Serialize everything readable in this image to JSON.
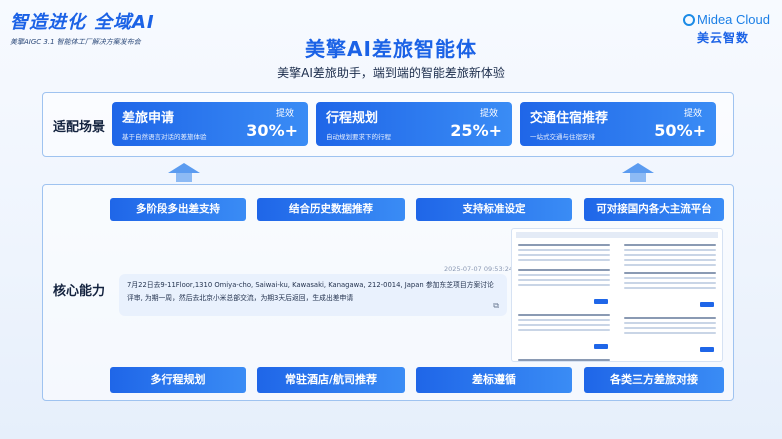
{
  "header": {
    "brand_title_1": "智造进化",
    "brand_title_2": "全域AI",
    "brand_sub": "美擎AIGC 3.1 智能体工厂解决方案发布会",
    "logo_en": "Midea Cloud",
    "logo_cn": "美云智数"
  },
  "title": "美擎AI差旅智能体",
  "subtitle": "美擎AI差旅助手，端到端的智能差旅新体验",
  "scenes": {
    "label": "适配场景",
    "cards": [
      {
        "title": "差旅申请",
        "desc": "基于自然语言对话的差旅体验",
        "kpi_label": "提效",
        "kpi_value": "30%+"
      },
      {
        "title": "行程规划",
        "desc": "自动规划要求下的行程",
        "kpi_label": "提效",
        "kpi_value": "25%+"
      },
      {
        "title": "交通住宿推荐",
        "desc": "一站式交通与住宿安排",
        "kpi_label": "提效",
        "kpi_value": "50%+"
      }
    ]
  },
  "core": {
    "label": "核心能力",
    "top_features": [
      "多阶段多出差支持",
      "结合历史数据推荐",
      "支持标准设定",
      "可对接国内各大主流平台"
    ],
    "bottom_features": [
      "多行程规划",
      "常驻酒店/航司推荐",
      "差标遵循",
      "各类三方差旅对接"
    ],
    "chat": {
      "timestamp": "2025-07-07 09:53:24",
      "message": "7月22日去9-11Floor,1310 Omiya-cho, Saiwai-ku, Kawasaki, Kanagawa, 212-0014, Japan 参加东芝项目方案讨论评审, 为期一周，然后去北京小米总部交流，为期3天后返回，生成出差申请",
      "icon": "copy-icon"
    }
  },
  "colors": {
    "accent": "#1f66e8",
    "accent_light": "#3a8cf5",
    "panel_border": "#9fc3f0"
  }
}
